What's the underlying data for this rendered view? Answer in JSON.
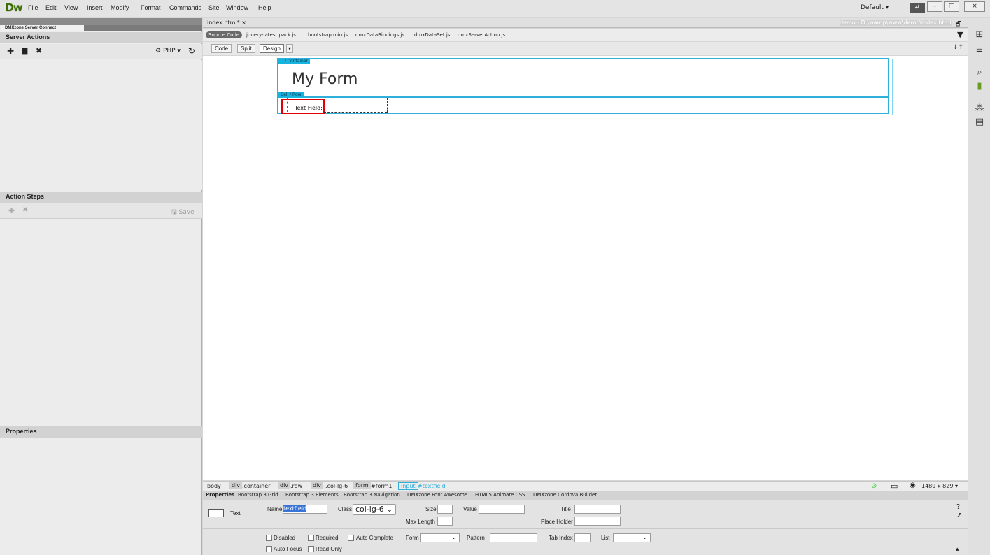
{
  "app": {
    "logo": "Dw",
    "workspace": "Default"
  },
  "menu": [
    "File",
    "Edit",
    "View",
    "Insert",
    "Modify",
    "Format",
    "Commands",
    "Site",
    "Window",
    "Help"
  ],
  "window_buttons": [
    "–",
    "□",
    "×"
  ],
  "left_panel": {
    "tab": "DMXzone Server Connect",
    "server_actions": {
      "title": "Server Actions",
      "lang": "PHP"
    },
    "action_steps": {
      "title": "Action Steps",
      "save_label": "Save"
    },
    "properties": {
      "title": "Properties"
    }
  },
  "document": {
    "tab": "index.html*",
    "path": "demo - D:\\wamp\\www\\demo\\index.html",
    "related_files": [
      "Source Code",
      "jquery-latest.pack.js",
      "bootstrap.min.js",
      "dmxDataBindings.js",
      "dmxDataSet.js",
      "dmxServerAction.js"
    ],
    "views": {
      "code": "Code",
      "split": "Split",
      "design": "Design"
    }
  },
  "canvas": {
    "container_tag": "/ Container",
    "heading": "My Form",
    "row_tag": "Cell / Row",
    "field_label": "Text Field:"
  },
  "tag_selector": [
    "body",
    "div",
    ".container",
    "div",
    ".row",
    "div",
    ".col-lg-6",
    "form",
    "#form1",
    "input",
    "#textfield"
  ],
  "status": {
    "size": "1489 x 829"
  },
  "property_tabs": [
    "Properties",
    "Bootstrap 3 Grid",
    "Bootstrap 3 Elements",
    "Bootstrap 3 Navigation",
    "DMXzone Font Awesome",
    "HTML5 Animate CSS",
    "DMXzone Cordova Builder"
  ],
  "properties": {
    "type": "Text",
    "name_label": "Name",
    "name_value": "textfield",
    "class_label": "Class",
    "class_value": "col-lg-6",
    "size_label": "Size",
    "maxlength_label": "Max Length",
    "value_label": "Value",
    "title_label": "Title",
    "placeholder_label": "Place Holder",
    "disabled": "Disabled",
    "required": "Required",
    "autocomplete": "Auto Complete",
    "autofocus": "Auto Focus",
    "readonly": "Read Only",
    "form_label": "Form",
    "pattern_label": "Pattern",
    "tabindex_label": "Tab Index",
    "list_label": "List"
  }
}
